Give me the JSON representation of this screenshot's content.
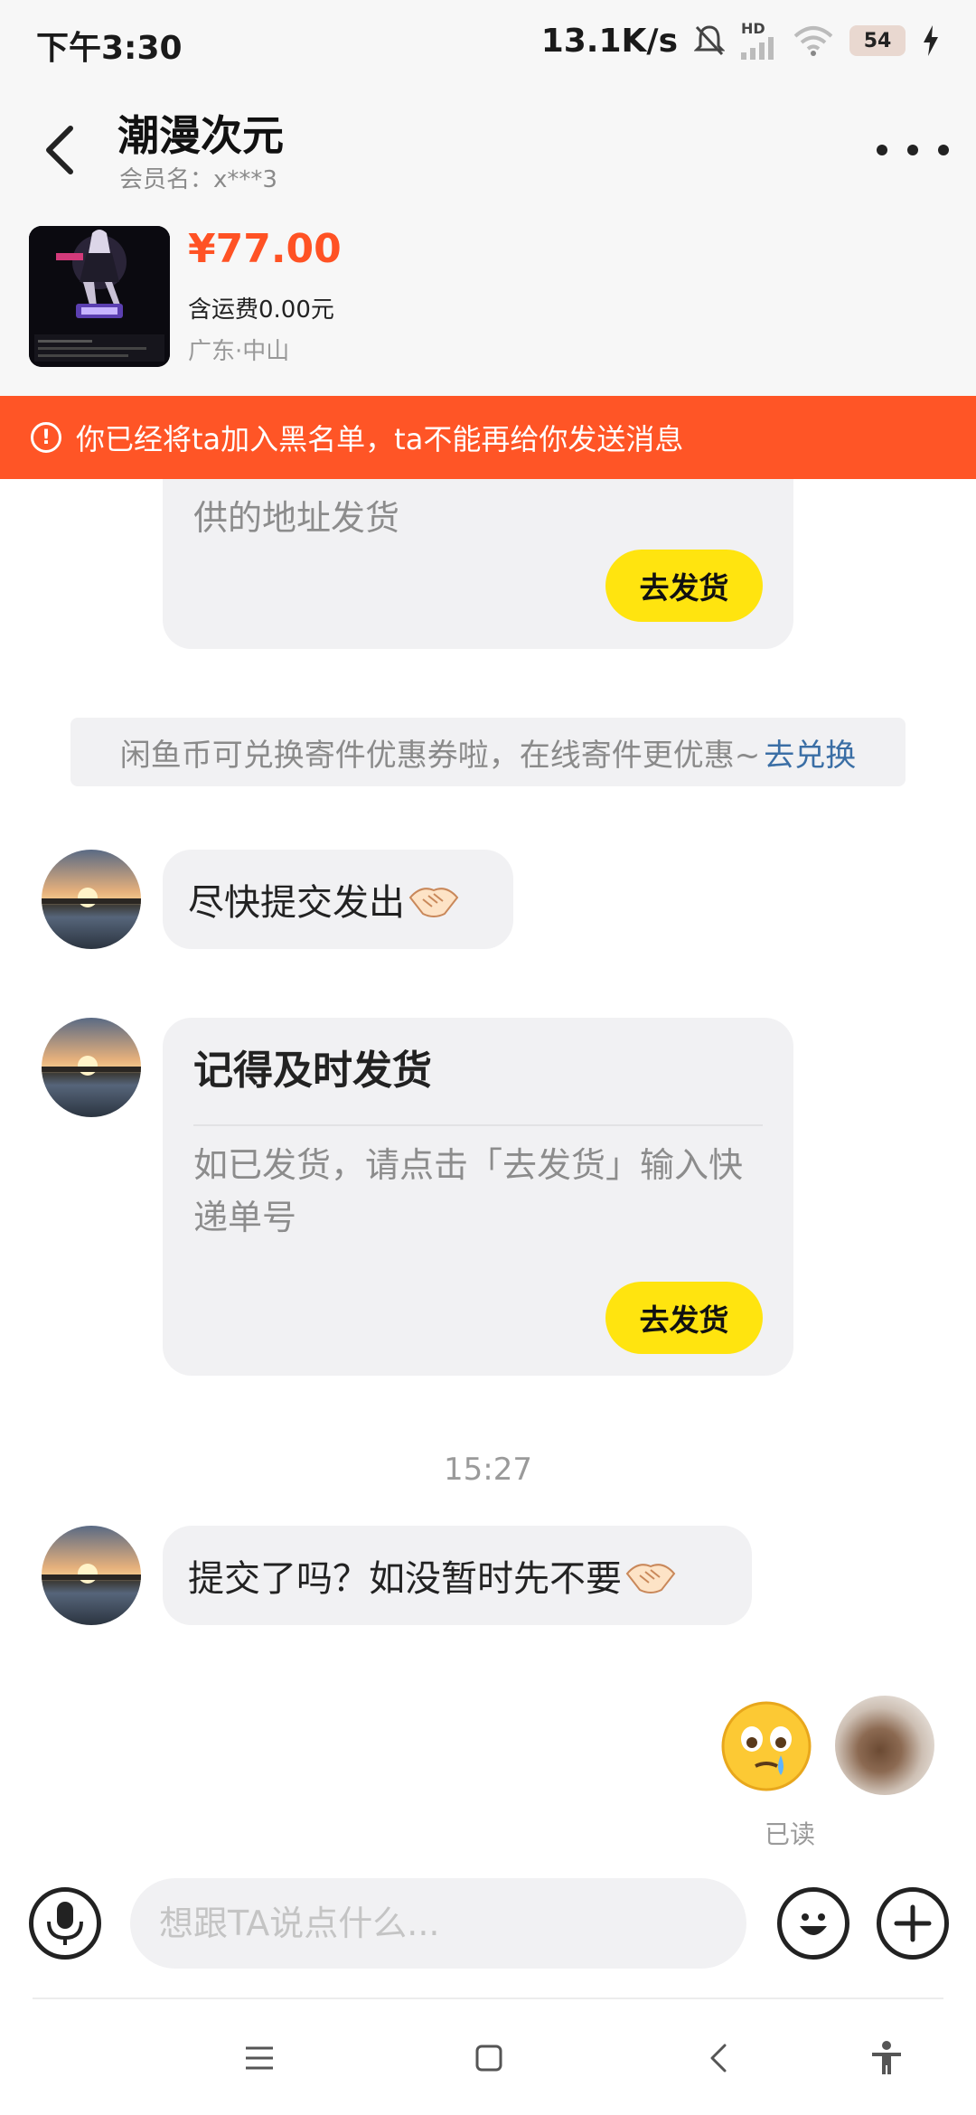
{
  "status_bar": {
    "time": "下午3:30",
    "net_speed": "13.1K/s",
    "hd_label": "HD",
    "battery_level": "54"
  },
  "header": {
    "shop_name": "潮漫次元",
    "member_label": "会员名：",
    "member_value": "x***3"
  },
  "product": {
    "price": "¥77.00",
    "shipping": "含运费0.00元",
    "location": "广东·中山"
  },
  "banner": {
    "text": "你已经将ta加入黑名单，ta不能再给你发送消息"
  },
  "chat": {
    "card1": {
      "body_tail": "供的地址发货",
      "button": "去发货"
    },
    "notice": {
      "text": "闲鱼币可兑换寄件优惠券啦，在线寄件更优惠~",
      "link": "去兑换"
    },
    "msg1": "尽快提交发出",
    "card2": {
      "title": "记得及时发货",
      "body": "如已发货，请点击「去发货」输入快递单号",
      "button": "去发货"
    },
    "timestamp": "15:27",
    "msg2": "提交了吗？如没暂时先不要",
    "read_status": "已读"
  },
  "input": {
    "placeholder": "想跟TA说点什么..."
  },
  "colors": {
    "accent": "#ff5526",
    "price": "#ff5224",
    "ship_button": "#ffe40f",
    "link": "#3a6ea5"
  }
}
